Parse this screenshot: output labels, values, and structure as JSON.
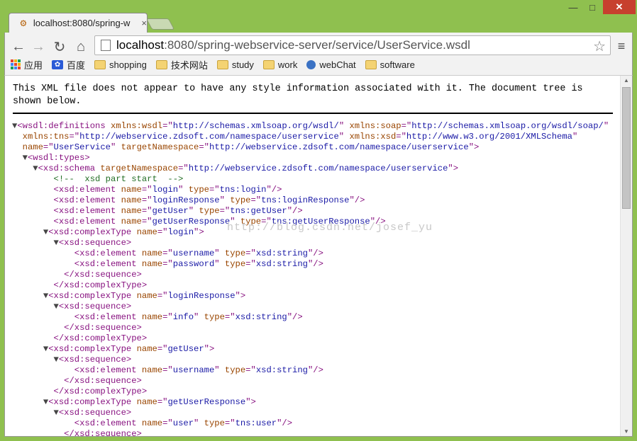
{
  "tab": {
    "title": "localhost:8080/spring-w",
    "close": "×",
    "favicon": "xml-file-icon"
  },
  "window": {
    "minimize": "—",
    "maximize": "□",
    "close": "✕"
  },
  "nav": {
    "back": "←",
    "forward": "→",
    "reload": "↻",
    "home": "⌂"
  },
  "omnibox": {
    "host": "localhost",
    "path": ":8080/spring-webservice-server/service/UserService.wsdl",
    "star": "☆"
  },
  "menu": "≡",
  "bookmarks": [
    {
      "label": "应用",
      "icon": "apps-grid-icon"
    },
    {
      "label": "百度",
      "icon": "baidu-paw-icon"
    },
    {
      "label": "shopping",
      "icon": "folder-icon"
    },
    {
      "label": "技术网站",
      "icon": "folder-icon"
    },
    {
      "label": "study",
      "icon": "folder-icon"
    },
    {
      "label": "work",
      "icon": "folder-icon"
    },
    {
      "label": "webChat",
      "icon": "webchat-icon"
    },
    {
      "label": "software",
      "icon": "folder-icon"
    }
  ],
  "notice": "This XML file does not appear to have any style information associated with it. The document tree is shown below.",
  "watermark": "http://blog.csdn.net/josef_yu",
  "xml": [
    [
      0,
      "▼",
      [
        [
          "tg",
          "<wsdl:definitions "
        ],
        [
          "at",
          "xmlns:wsdl"
        ],
        [
          "tg",
          "=\""
        ],
        [
          "vl",
          "http://schemas.xmlsoap.org/wsdl/"
        ],
        [
          "tg",
          "\" "
        ],
        [
          "at",
          "xmlns:soap"
        ],
        [
          "tg",
          "=\""
        ],
        [
          "vl",
          "http://schemas.xmlsoap.org/wsdl/soap/"
        ],
        [
          "tg",
          "\""
        ]
      ]
    ],
    [
      1,
      "",
      [
        [
          "at",
          "xmlns:tns"
        ],
        [
          "tg",
          "=\""
        ],
        [
          "vl",
          "http://webservice.zdsoft.com/namespace/userservice"
        ],
        [
          "tg",
          "\" "
        ],
        [
          "at",
          "xmlns:xsd"
        ],
        [
          "tg",
          "=\""
        ],
        [
          "vl",
          "http://www.w3.org/2001/XMLSchema"
        ],
        [
          "tg",
          "\""
        ]
      ]
    ],
    [
      1,
      "",
      [
        [
          "at",
          "name"
        ],
        [
          "tg",
          "=\""
        ],
        [
          "vl",
          "UserService"
        ],
        [
          "tg",
          "\" "
        ],
        [
          "at",
          "targetNamespace"
        ],
        [
          "tg",
          "=\""
        ],
        [
          "vl",
          "http://webservice.zdsoft.com/namespace/userservice"
        ],
        [
          "tg",
          "\">"
        ]
      ]
    ],
    [
      1,
      "▼",
      [
        [
          "tg",
          "<wsdl:types>"
        ]
      ]
    ],
    [
      2,
      "▼",
      [
        [
          "tg",
          "<xsd:schema "
        ],
        [
          "at",
          "targetNamespace"
        ],
        [
          "tg",
          "=\""
        ],
        [
          "vl",
          "http://webservice.zdsoft.com/namespace/userservice"
        ],
        [
          "tg",
          "\">"
        ]
      ]
    ],
    [
      4,
      "",
      [
        [
          "cm",
          "<!--  xsd part start  -->"
        ]
      ]
    ],
    [
      4,
      "",
      [
        [
          "tg",
          "<xsd:element "
        ],
        [
          "at",
          "name"
        ],
        [
          "tg",
          "=\""
        ],
        [
          "vl",
          "login"
        ],
        [
          "tg",
          "\" "
        ],
        [
          "at",
          "type"
        ],
        [
          "tg",
          "=\""
        ],
        [
          "vl",
          "tns:login"
        ],
        [
          "tg",
          "\"/>"
        ]
      ]
    ],
    [
      4,
      "",
      [
        [
          "tg",
          "<xsd:element "
        ],
        [
          "at",
          "name"
        ],
        [
          "tg",
          "=\""
        ],
        [
          "vl",
          "loginResponse"
        ],
        [
          "tg",
          "\" "
        ],
        [
          "at",
          "type"
        ],
        [
          "tg",
          "=\""
        ],
        [
          "vl",
          "tns:loginResponse"
        ],
        [
          "tg",
          "\"/>"
        ]
      ]
    ],
    [
      4,
      "",
      [
        [
          "tg",
          "<xsd:element "
        ],
        [
          "at",
          "name"
        ],
        [
          "tg",
          "=\""
        ],
        [
          "vl",
          "getUser"
        ],
        [
          "tg",
          "\" "
        ],
        [
          "at",
          "type"
        ],
        [
          "tg",
          "=\""
        ],
        [
          "vl",
          "tns:getUser"
        ],
        [
          "tg",
          "\"/>"
        ]
      ]
    ],
    [
      4,
      "",
      [
        [
          "tg",
          "<xsd:element "
        ],
        [
          "at",
          "name"
        ],
        [
          "tg",
          "=\""
        ],
        [
          "vl",
          "getUserResponse"
        ],
        [
          "tg",
          "\" "
        ],
        [
          "at",
          "type"
        ],
        [
          "tg",
          "=\""
        ],
        [
          "vl",
          "tns:getUserResponse"
        ],
        [
          "tg",
          "\"/>"
        ]
      ]
    ],
    [
      3,
      "▼",
      [
        [
          "tg",
          "<xsd:complexType "
        ],
        [
          "at",
          "name"
        ],
        [
          "tg",
          "=\""
        ],
        [
          "vl",
          "login"
        ],
        [
          "tg",
          "\">"
        ]
      ]
    ],
    [
      4,
      "▼",
      [
        [
          "tg",
          "<xsd:sequence>"
        ]
      ]
    ],
    [
      6,
      "",
      [
        [
          "tg",
          "<xsd:element "
        ],
        [
          "at",
          "name"
        ],
        [
          "tg",
          "=\""
        ],
        [
          "vl",
          "username"
        ],
        [
          "tg",
          "\" "
        ],
        [
          "at",
          "type"
        ],
        [
          "tg",
          "=\""
        ],
        [
          "vl",
          "xsd:string"
        ],
        [
          "tg",
          "\"/>"
        ]
      ]
    ],
    [
      6,
      "",
      [
        [
          "tg",
          "<xsd:element "
        ],
        [
          "at",
          "name"
        ],
        [
          "tg",
          "=\""
        ],
        [
          "vl",
          "password"
        ],
        [
          "tg",
          "\" "
        ],
        [
          "at",
          "type"
        ],
        [
          "tg",
          "=\""
        ],
        [
          "vl",
          "xsd:string"
        ],
        [
          "tg",
          "\"/>"
        ]
      ]
    ],
    [
      5,
      "",
      [
        [
          "tg",
          "</xsd:sequence>"
        ]
      ]
    ],
    [
      4,
      "",
      [
        [
          "tg",
          "</xsd:complexType>"
        ]
      ]
    ],
    [
      3,
      "▼",
      [
        [
          "tg",
          "<xsd:complexType "
        ],
        [
          "at",
          "name"
        ],
        [
          "tg",
          "=\""
        ],
        [
          "vl",
          "loginResponse"
        ],
        [
          "tg",
          "\">"
        ]
      ]
    ],
    [
      4,
      "▼",
      [
        [
          "tg",
          "<xsd:sequence>"
        ]
      ]
    ],
    [
      6,
      "",
      [
        [
          "tg",
          "<xsd:element "
        ],
        [
          "at",
          "name"
        ],
        [
          "tg",
          "=\""
        ],
        [
          "vl",
          "info"
        ],
        [
          "tg",
          "\" "
        ],
        [
          "at",
          "type"
        ],
        [
          "tg",
          "=\""
        ],
        [
          "vl",
          "xsd:string"
        ],
        [
          "tg",
          "\"/>"
        ]
      ]
    ],
    [
      5,
      "",
      [
        [
          "tg",
          "</xsd:sequence>"
        ]
      ]
    ],
    [
      4,
      "",
      [
        [
          "tg",
          "</xsd:complexType>"
        ]
      ]
    ],
    [
      3,
      "▼",
      [
        [
          "tg",
          "<xsd:complexType "
        ],
        [
          "at",
          "name"
        ],
        [
          "tg",
          "=\""
        ],
        [
          "vl",
          "getUser"
        ],
        [
          "tg",
          "\">"
        ]
      ]
    ],
    [
      4,
      "▼",
      [
        [
          "tg",
          "<xsd:sequence>"
        ]
      ]
    ],
    [
      6,
      "",
      [
        [
          "tg",
          "<xsd:element "
        ],
        [
          "at",
          "name"
        ],
        [
          "tg",
          "=\""
        ],
        [
          "vl",
          "username"
        ],
        [
          "tg",
          "\" "
        ],
        [
          "at",
          "type"
        ],
        [
          "tg",
          "=\""
        ],
        [
          "vl",
          "xsd:string"
        ],
        [
          "tg",
          "\"/>"
        ]
      ]
    ],
    [
      5,
      "",
      [
        [
          "tg",
          "</xsd:sequence>"
        ]
      ]
    ],
    [
      4,
      "",
      [
        [
          "tg",
          "</xsd:complexType>"
        ]
      ]
    ],
    [
      3,
      "▼",
      [
        [
          "tg",
          "<xsd:complexType "
        ],
        [
          "at",
          "name"
        ],
        [
          "tg",
          "=\""
        ],
        [
          "vl",
          "getUserResponse"
        ],
        [
          "tg",
          "\">"
        ]
      ]
    ],
    [
      4,
      "▼",
      [
        [
          "tg",
          "<xsd:sequence>"
        ]
      ]
    ],
    [
      6,
      "",
      [
        [
          "tg",
          "<xsd:element "
        ],
        [
          "at",
          "name"
        ],
        [
          "tg",
          "=\""
        ],
        [
          "vl",
          "user"
        ],
        [
          "tg",
          "\" "
        ],
        [
          "at",
          "type"
        ],
        [
          "tg",
          "=\""
        ],
        [
          "vl",
          "tns:user"
        ],
        [
          "tg",
          "\"/>"
        ]
      ]
    ],
    [
      5,
      "",
      [
        [
          "tg",
          "</xsd:sequence>"
        ]
      ]
    ]
  ]
}
